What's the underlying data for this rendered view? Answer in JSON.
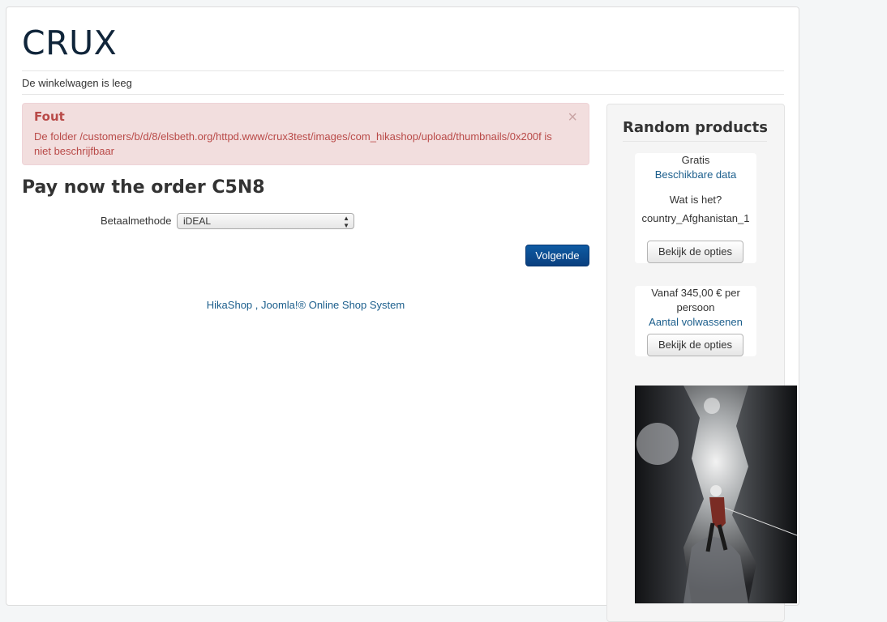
{
  "site": {
    "brand": "CRUX"
  },
  "cart": {
    "status": "De winkelwagen is leeg"
  },
  "alert": {
    "title": "Fout",
    "message": "De folder /customers/b/d/8/elsbeth.org/httpd.www/crux3test/images/com_hikashop/upload/thumbnails/0x200f is niet beschrijfbaar",
    "close_glyph": "×"
  },
  "order": {
    "title": "Pay now the order C5N8",
    "payment_label": "Betaalmethode",
    "payment_selected": "iDEAL",
    "next_label": "Volgende"
  },
  "footer": {
    "link1": "HikaShop",
    "separator": " , ",
    "link2": "Joomla!® Online Shop System"
  },
  "sidebar": {
    "title": "Random products",
    "products": [
      {
        "price": "Gratis",
        "link": "Beschikbare data",
        "question": "Wat is het?",
        "value": "country_Afghanistan_1",
        "button": "Bekijk de opties"
      },
      {
        "price_line1": "Vanaf 345,00 € per",
        "price_line2": "persoon",
        "link": "Aantal volwassenen",
        "button": "Bekijk de opties"
      }
    ]
  }
}
